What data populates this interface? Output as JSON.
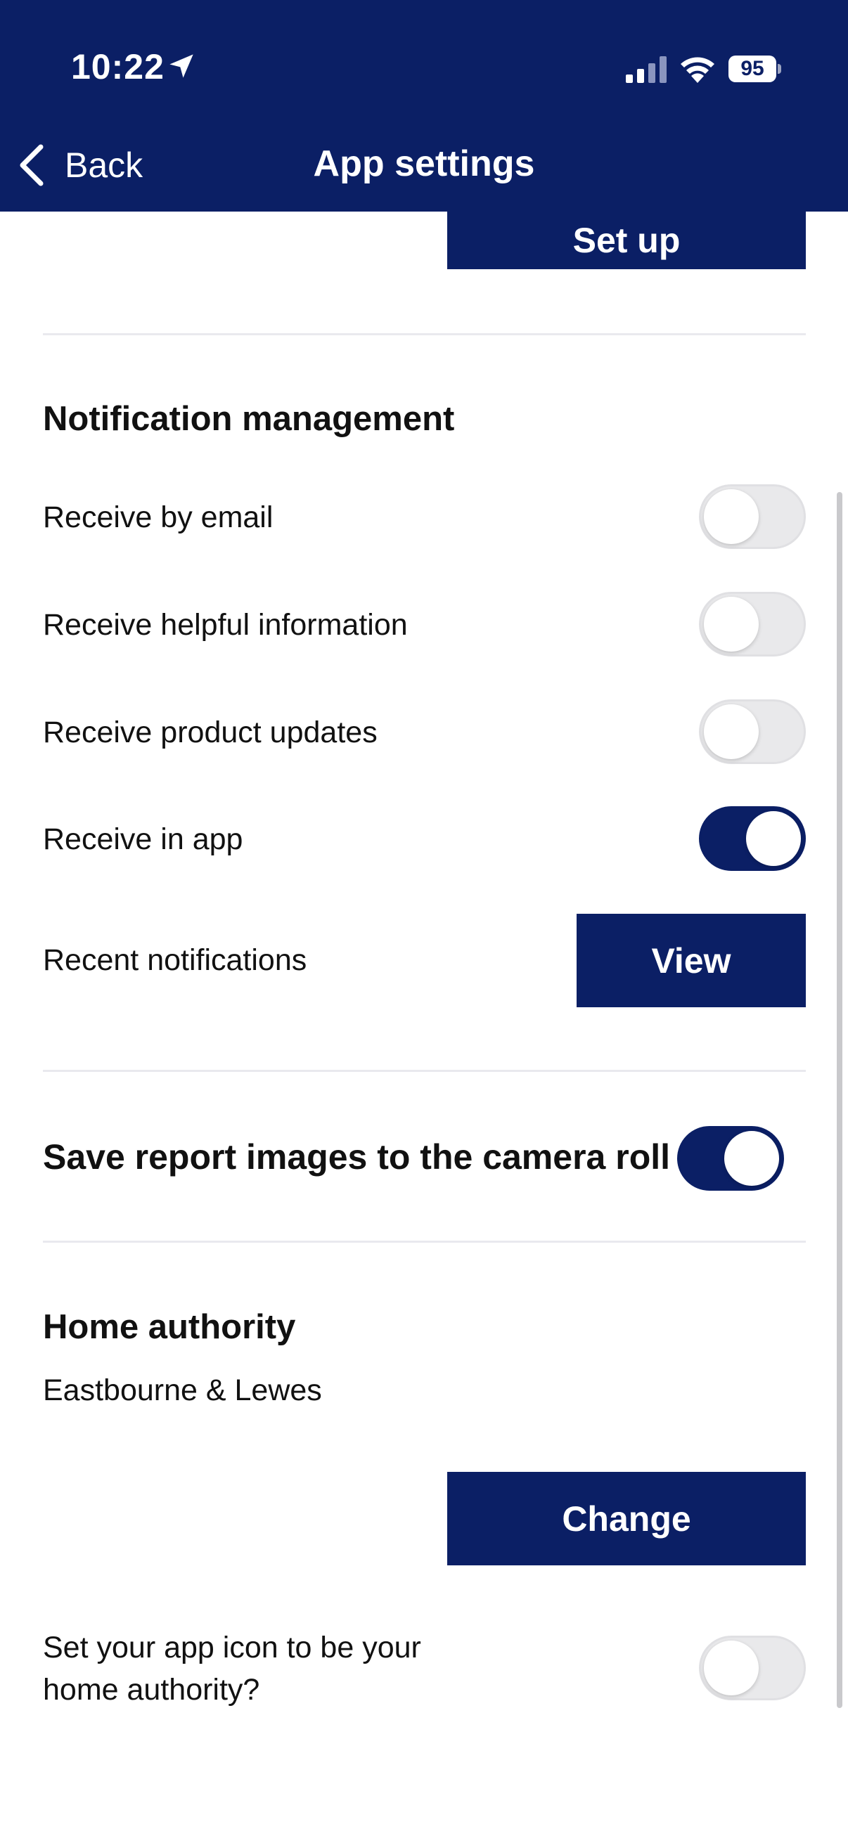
{
  "status_bar": {
    "time": "10:22",
    "battery": "95",
    "icons": [
      "location-arrow-icon",
      "cellular-signal-icon",
      "wifi-icon",
      "battery-icon"
    ]
  },
  "nav": {
    "back_label": "Back",
    "title": "App settings"
  },
  "setup_button": {
    "label": "Set up"
  },
  "notifications": {
    "heading": "Notification management",
    "rows": [
      {
        "label": "Receive by email",
        "on": false
      },
      {
        "label": "Receive helpful information",
        "on": false
      },
      {
        "label": "Receive product updates",
        "on": false
      },
      {
        "label": "Receive in app",
        "on": true
      }
    ],
    "recent_label": "Recent notifications",
    "view_label": "View"
  },
  "camera_roll": {
    "label": "Save report images to the camera roll",
    "on": true
  },
  "home_authority": {
    "heading": "Home authority",
    "value": "Eastbourne & Lewes",
    "change_label": "Change",
    "icon_prompt_line1": "Set your app icon to be your",
    "icon_prompt_line2": "home authority?",
    "icon_toggle_on": false
  },
  "colors": {
    "brand": "#0b1f65",
    "toggle_off": "#e9e9eb",
    "divider": "#e9e9ee"
  }
}
